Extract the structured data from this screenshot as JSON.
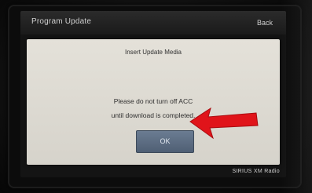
{
  "window": {
    "title": "Program Update",
    "back_label": "Back"
  },
  "dialog": {
    "heading": "Insert Update Media",
    "message_line_1": "Please do not turn off ACC",
    "message_line_2": "until download is completed.",
    "ok_label": "OK"
  },
  "footer": {
    "brand_text": "SIRIUS XM Radio"
  },
  "annotation": {
    "arrow_icon": "red-arrow-pointing-left",
    "arrow_color": "#e0141a"
  },
  "colors": {
    "dialog_background": "#dcd9d1",
    "ok_button": "#5d6d82",
    "titlebar": "#222222"
  }
}
